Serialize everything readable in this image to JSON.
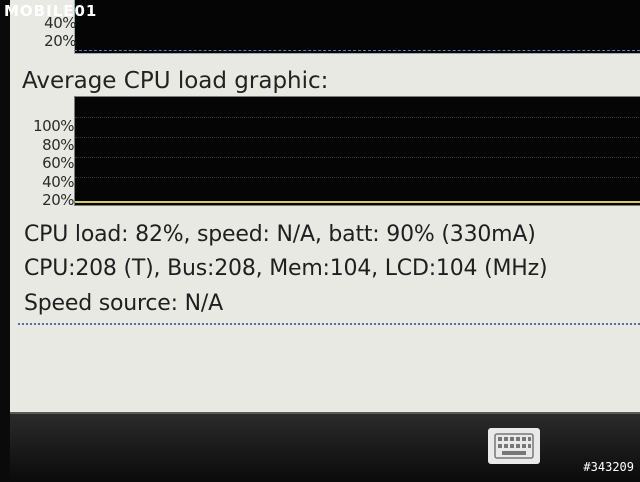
{
  "watermark": {
    "logo_text": "MOBILE01",
    "id_text": "#343209"
  },
  "top_graph": {
    "y_labels": [
      "40%",
      "20%"
    ]
  },
  "average_graph": {
    "title": "Average CPU load graphic:",
    "y_labels": [
      "100%",
      "80%",
      "60%",
      "40%",
      "20%"
    ]
  },
  "info": {
    "line1": "CPU load: 82%, speed: N/A, batt: 90% (330mA)",
    "line2": "CPU:208 (T), Bus:208, Mem:104, LCD:104 (MHz)",
    "line3": "Speed source: N/A"
  },
  "taskbar": {
    "keyboard_icon": "keyboard-icon"
  },
  "colors": {
    "screen_bg": "#e9e9e4",
    "graph_bg": "#050505",
    "graph_baseline": "#d8c870",
    "separator": "#5c6f9c"
  }
}
